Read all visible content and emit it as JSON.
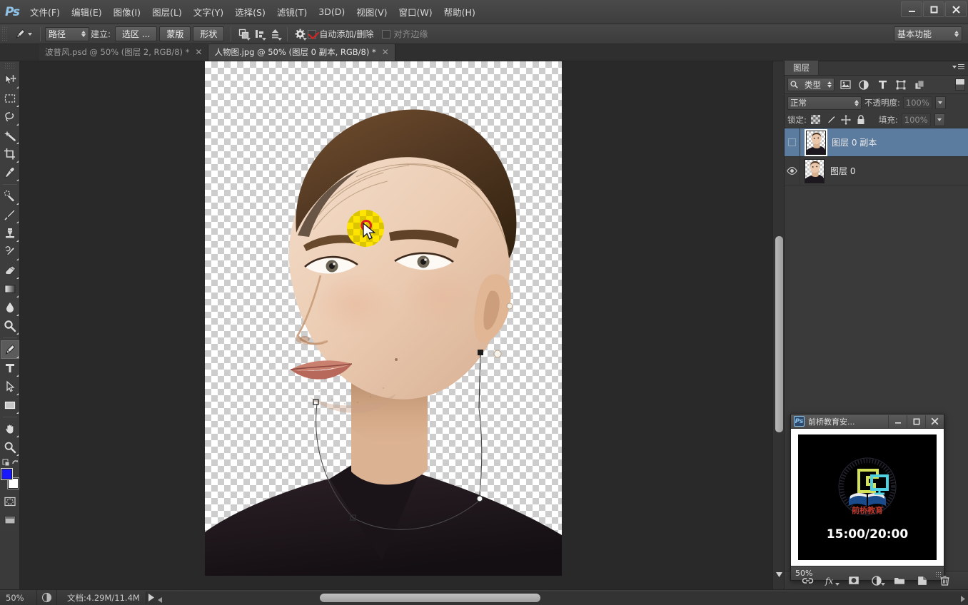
{
  "app": {
    "logo": "Ps",
    "title": "Adobe Photoshop",
    "window_controls": {
      "minimize": "—",
      "maximize": "▫",
      "close": "✕"
    }
  },
  "menubar": {
    "items": [
      {
        "label": "文件(F)"
      },
      {
        "label": "编辑(E)"
      },
      {
        "label": "图像(I)"
      },
      {
        "label": "图层(L)"
      },
      {
        "label": "文字(Y)"
      },
      {
        "label": "选择(S)"
      },
      {
        "label": "滤镜(T)"
      },
      {
        "label": "3D(D)"
      },
      {
        "label": "视图(V)"
      },
      {
        "label": "窗口(W)"
      },
      {
        "label": "帮助(H)"
      }
    ]
  },
  "options_bar": {
    "tool_icon": "pen-tool-icon",
    "mode_value": "路径",
    "make_label": "建立:",
    "buttons": [
      {
        "label": "选区 ..."
      },
      {
        "label": "蒙版"
      },
      {
        "label": "形状"
      }
    ],
    "path_op_icons": [
      "path-operations-icon",
      "path-alignment-icon",
      "path-arrangement-icon"
    ],
    "gear_icon": "gear-icon",
    "auto_add_delete": {
      "label": "自动添加/删除",
      "checked": true
    },
    "align_edges": {
      "label": "对齐边缘",
      "checked": false
    },
    "workspace": "基本功能"
  },
  "tabs": [
    {
      "label": "波普风.psd @ 50% (图层 2, RGB/8) *",
      "active": false,
      "close": "✕"
    },
    {
      "label": "人物图.jpg @ 50% (图层 0 副本, RGB/8) *",
      "active": true,
      "close": "✕"
    }
  ],
  "toolbar": {
    "tools": [
      {
        "name": "move-tool",
        "icon": "move-icon",
        "active": false
      },
      {
        "name": "marquee-tool",
        "icon": "rectangular-marquee-icon",
        "active": false
      },
      {
        "name": "lasso-tool",
        "icon": "lasso-icon",
        "active": false
      },
      {
        "name": "magic-wand-tool",
        "icon": "magic-wand-icon",
        "active": false
      },
      {
        "name": "crop-tool",
        "icon": "crop-icon",
        "active": false
      },
      {
        "name": "eyedropper-tool",
        "icon": "eyedropper-icon",
        "active": false
      },
      {
        "name": "healing-brush-tool",
        "icon": "healing-brush-icon",
        "active": false
      },
      {
        "name": "brush-tool",
        "icon": "brush-icon",
        "active": false
      },
      {
        "name": "clone-stamp-tool",
        "icon": "clone-stamp-icon",
        "active": false
      },
      {
        "name": "history-brush-tool",
        "icon": "history-brush-icon",
        "active": false
      },
      {
        "name": "eraser-tool",
        "icon": "eraser-icon",
        "active": false
      },
      {
        "name": "gradient-tool",
        "icon": "gradient-icon",
        "active": false
      },
      {
        "name": "blur-tool",
        "icon": "blur-drop-icon",
        "active": false
      },
      {
        "name": "dodge-tool",
        "icon": "dodge-icon",
        "active": false
      },
      {
        "name": "pen-tool",
        "icon": "pen-icon",
        "active": true
      },
      {
        "name": "type-tool",
        "icon": "type-T-icon",
        "active": false
      },
      {
        "name": "path-selection-tool",
        "icon": "path-selection-arrow-icon",
        "active": false
      },
      {
        "name": "shape-tool",
        "icon": "rectangle-shape-icon",
        "active": false
      },
      {
        "name": "hand-tool",
        "icon": "hand-icon",
        "active": false
      },
      {
        "name": "zoom-tool",
        "icon": "magnifier-icon",
        "active": false
      }
    ],
    "foreground_color": "#1919ff",
    "background_color": "#ffffff",
    "quick_mask": "quick-mask-icon",
    "screen_mode": "screen-mode-icon"
  },
  "canvas": {
    "zoom": "50%",
    "transparency": "checkerboard",
    "path_points": 5,
    "cursor": {
      "tool": "pen-cursor",
      "highlight_color": "#ffe400",
      "click_ring_color": "#e02020"
    }
  },
  "statusbar": {
    "zoom": "50%",
    "doc_icon": "document-icon",
    "doc_info": "文档:4.29M/11.4M",
    "play_arrow": "▶",
    "left_arrow": "◀"
  },
  "layers_panel": {
    "title": "图层",
    "menu_icon": "panel-menu-icon",
    "filter": {
      "search_icon": "search-icon",
      "value": "类型",
      "icons": [
        "pixel-layer-filter-icon",
        "adjustment-layer-filter-icon",
        "type-layer-filter-icon",
        "shape-layer-filter-icon",
        "smart-object-filter-icon"
      ],
      "toggle": "filter-toggle-icon"
    },
    "blend_mode": "正常",
    "opacity_label": "不透明度:",
    "opacity_value": "100%",
    "lock_label": "锁定:",
    "lock_icons": [
      "lock-transparency-icon",
      "lock-image-icon",
      "lock-position-icon",
      "lock-all-icon"
    ],
    "fill_label": "填充:",
    "fill_value": "100%",
    "layers": [
      {
        "name": "图层 0 副本",
        "visible": false,
        "selected": true
      },
      {
        "name": "图层 0",
        "visible": true,
        "selected": false
      }
    ],
    "footer_icons": [
      "link-layers-icon",
      "layer-fx-icon",
      "add-layer-mask-icon",
      "new-adjustment-layer-icon",
      "new-group-icon",
      "new-layer-icon",
      "delete-layer-icon"
    ]
  },
  "float_window": {
    "app_badge": "Ps",
    "title": "前桥教育安...",
    "controls": {
      "minimize": "—",
      "maximize": "▫",
      "close": "✕"
    },
    "logo_text": "前桥教育",
    "timer": "15:00/20:00",
    "zoom": "50%",
    "resize_grip": "resize-grip-icon",
    "colors": {
      "background": "#000000",
      "logo_red": "#c0392b",
      "logo_yellow": "#d4e157",
      "logo_cyan": "#4dd0e1",
      "logo_blue": "#1a4b8c"
    }
  }
}
